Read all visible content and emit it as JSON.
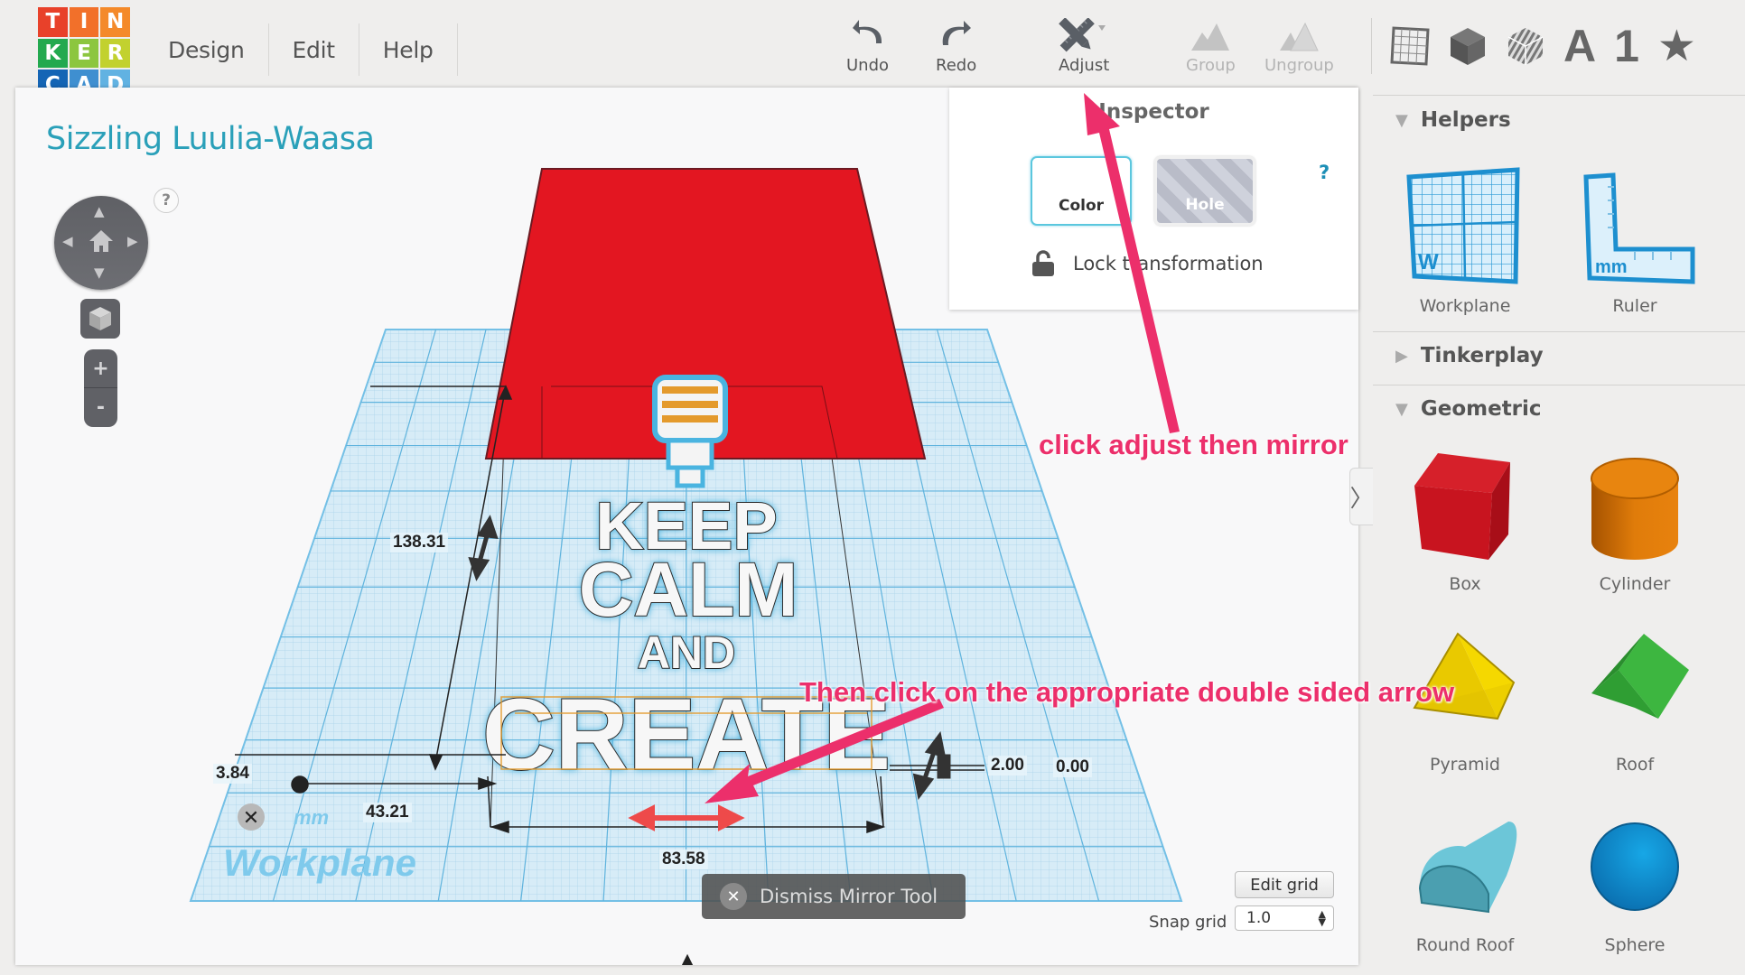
{
  "logo": {
    "letters": [
      "T",
      "I",
      "N",
      "K",
      "E",
      "R",
      "C",
      "A",
      "D"
    ],
    "colors": [
      "#e8412a",
      "#f2702a",
      "#f48a2a",
      "#23a94f",
      "#8cc63f",
      "#c2d12f",
      "#1565b5",
      "#3f8fd0",
      "#61b2e2"
    ]
  },
  "menu": [
    "Design",
    "Edit",
    "Help"
  ],
  "toolbar": {
    "undo": "Undo",
    "redo": "Redo",
    "adjust": "Adjust",
    "group": "Group",
    "ungroup": "Ungroup"
  },
  "right_icons": [
    "workplane-grid",
    "solid-box",
    "hole-box",
    "A",
    "1",
    "★"
  ],
  "design_title": "Sizzling Luulia-Waasa",
  "inspector": {
    "title": "Inspector",
    "color_label": "Color",
    "hole_label": "Hole",
    "help": "?",
    "lock_label": "Lock transformation"
  },
  "view_controls": {
    "help": "?",
    "zoom_in": "+",
    "zoom_out": "-"
  },
  "dimensions": {
    "depth": "138.31",
    "x_offset": "3.84",
    "y_offset": "43.21",
    "width": "83.58",
    "height": "2.00",
    "elevation": "0.00",
    "units": "mm"
  },
  "workplane_label": "Workplane",
  "sidebar": {
    "sections": [
      {
        "name": "Helpers",
        "expanded": true,
        "items": [
          "Workplane",
          "Ruler"
        ]
      },
      {
        "name": "Tinkerplay",
        "expanded": false,
        "items": []
      },
      {
        "name": "Geometric",
        "expanded": true,
        "items": [
          "Box",
          "Cylinder",
          "Pyramid",
          "Roof",
          "Round Roof",
          "Sphere"
        ]
      }
    ]
  },
  "dismiss_label": "Dismiss Mirror Tool",
  "grid": {
    "edit_label": "Edit grid",
    "snap_label": "Snap grid",
    "snap_value": "1.0"
  },
  "annotations": {
    "a1": "click adjust then mirror",
    "a2": "Then click on the appropriate double sided arrow",
    "color": "#ec2f6b"
  },
  "model_text": [
    "KEEP",
    "CALM",
    "AND",
    "CREATE"
  ]
}
